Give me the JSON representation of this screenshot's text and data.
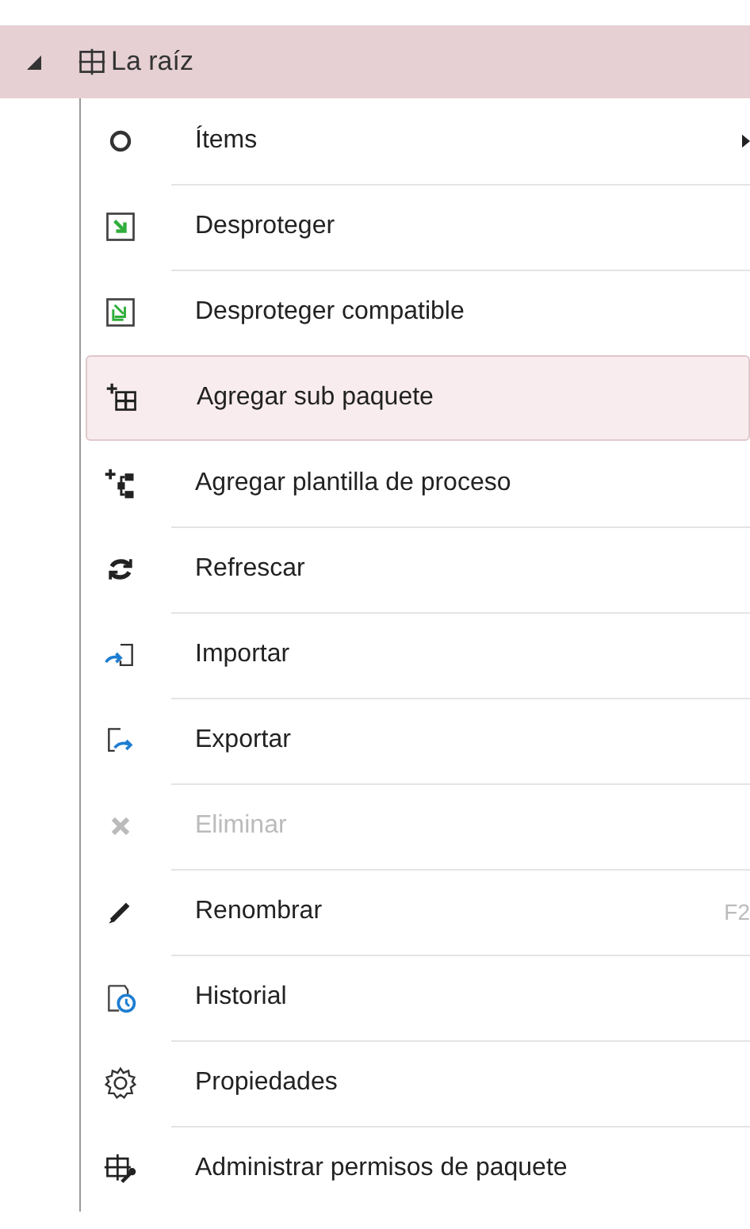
{
  "tree_node": {
    "label": "La raíz",
    "expanded": true,
    "selected": true
  },
  "context_menu": {
    "items": [
      {
        "label": "Ítems",
        "has_submenu": true,
        "selected": false,
        "disabled": false
      },
      {
        "label": "Desproteger",
        "has_submenu": false,
        "selected": false,
        "disabled": false
      },
      {
        "label": "Desproteger compatible",
        "has_submenu": false,
        "selected": false,
        "disabled": false
      },
      {
        "label": "Agregar sub paquete",
        "has_submenu": false,
        "selected": true,
        "disabled": false
      },
      {
        "label": "Agregar plantilla de proceso",
        "has_submenu": false,
        "selected": false,
        "disabled": false
      },
      {
        "label": "Refrescar",
        "has_submenu": false,
        "selected": false,
        "disabled": false
      },
      {
        "label": "Importar",
        "has_submenu": false,
        "selected": false,
        "disabled": false
      },
      {
        "label": "Exportar",
        "has_submenu": false,
        "selected": false,
        "disabled": false
      },
      {
        "label": "Eliminar",
        "has_submenu": false,
        "selected": false,
        "disabled": true
      },
      {
        "label": "Renombrar",
        "shortcut": "F2",
        "has_submenu": false,
        "selected": false,
        "disabled": false
      },
      {
        "label": "Historial",
        "has_submenu": false,
        "selected": false,
        "disabled": false
      },
      {
        "label": "Propiedades",
        "has_submenu": false,
        "selected": false,
        "disabled": false
      },
      {
        "label": "Administrar permisos de paquete",
        "has_submenu": false,
        "selected": false,
        "disabled": false
      }
    ]
  }
}
